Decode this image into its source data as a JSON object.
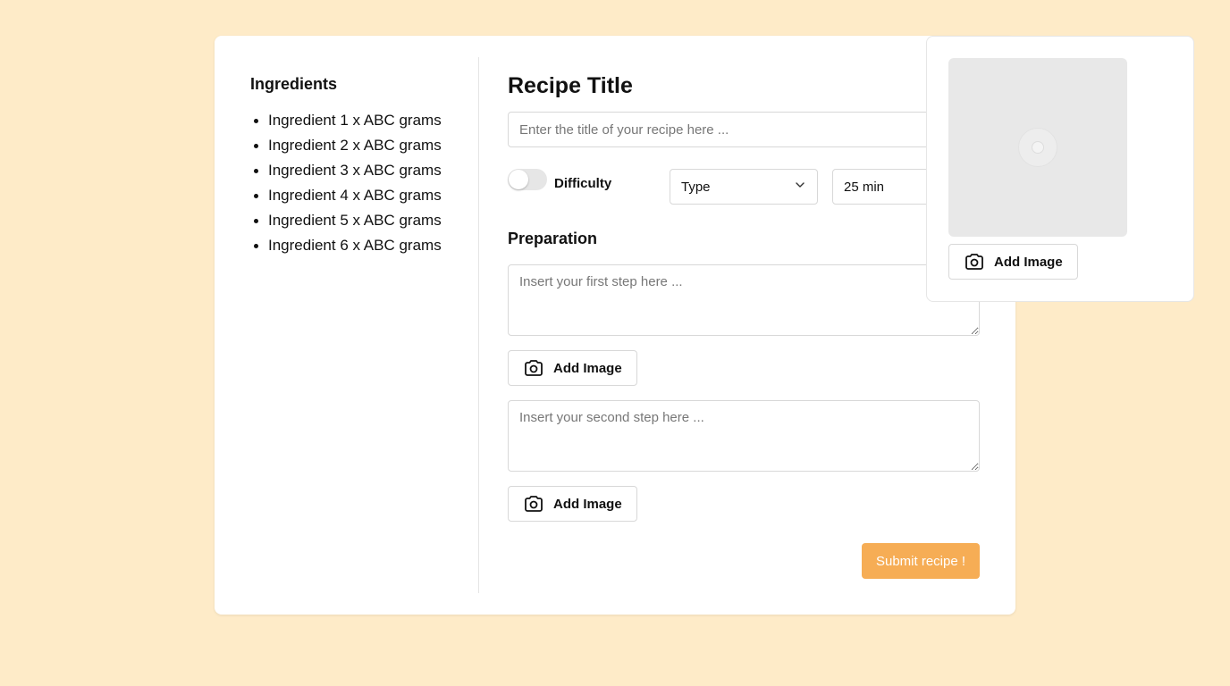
{
  "ingredients": {
    "title": "Ingredients",
    "items": [
      "Ingredient 1 x ABC grams",
      "Ingredient 2 x ABC grams",
      "Ingredient 3 x ABC grams",
      "Ingredient 4 x ABC grams",
      "Ingredient 5 x ABC grams",
      "Ingredient 6 x ABC grams"
    ]
  },
  "recipe": {
    "title": "Recipe Title",
    "title_placeholder": "Enter the title of your recipe here ...",
    "difficulty_label": "Difficulty",
    "difficulty_on": false,
    "type_value": "Type",
    "time_value": "25 min"
  },
  "preparation": {
    "title": "Preparation",
    "step1_placeholder": "Insert your first step here ...",
    "step2_placeholder": "Insert your second step here ...",
    "add_image_label": "Add Image"
  },
  "submit_label": "Submit recipe !",
  "side": {
    "add_image_label": "Add Image"
  },
  "colors": {
    "background": "#feebc8",
    "accent": "#f6ad55"
  },
  "icons": [
    "camera-icon",
    "chevron-down-icon",
    "image-loading-icon"
  ]
}
